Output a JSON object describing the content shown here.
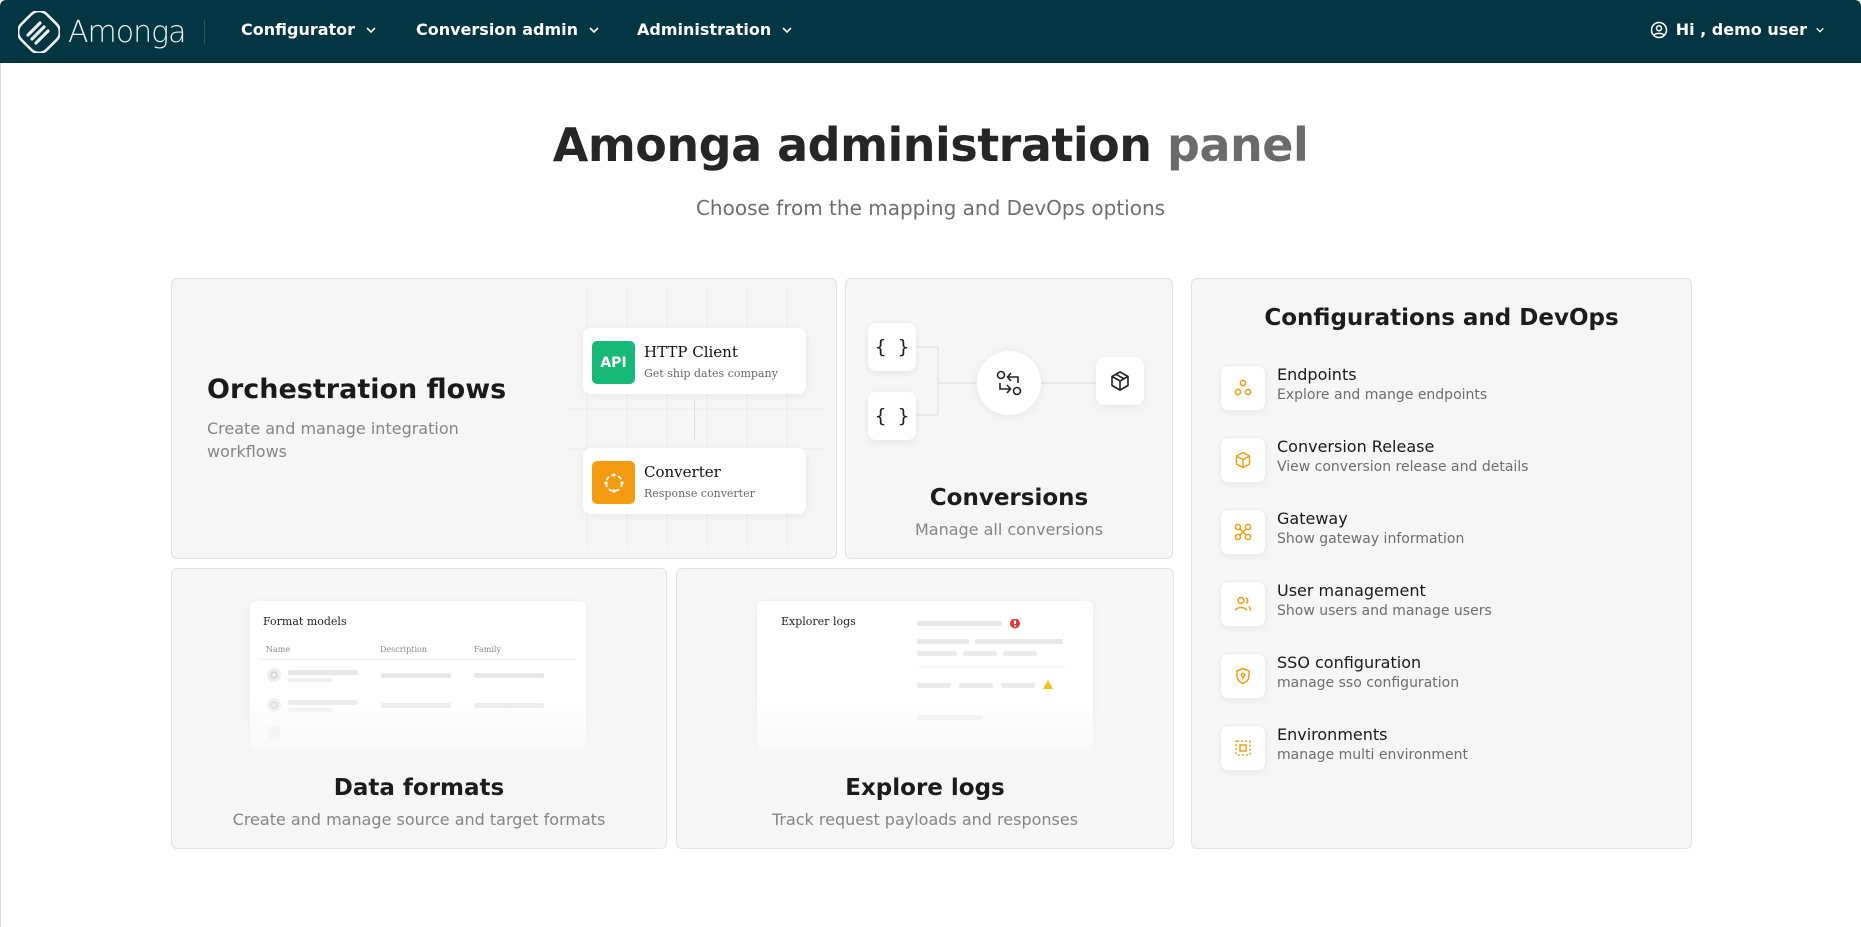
{
  "nav": {
    "logo_text": "Amonga",
    "menus": [
      {
        "label": "Configurator"
      },
      {
        "label": "Conversion admin"
      },
      {
        "label": "Administration"
      }
    ],
    "user_label": "Hi , demo user"
  },
  "hero": {
    "title_dark": "Amonga administration",
    "title_light": "panel",
    "subtitle": "Choose from the mapping and DevOps options"
  },
  "orchestration": {
    "title": "Orchestration flows",
    "description": "Create and manage integration workflows",
    "nodes": [
      {
        "badge": "API",
        "title": "HTTP Client",
        "subtitle": "Get ship dates company",
        "color": "#17b978"
      },
      {
        "badge": "",
        "title": "Converter",
        "subtitle": "Response converter",
        "color": "#f39c12"
      }
    ]
  },
  "conversions": {
    "title": "Conversions",
    "description": "Manage all conversions",
    "brace": "{ }"
  },
  "configurations": {
    "title": "Configurations and DevOps",
    "items": [
      {
        "label": "Endpoints",
        "description": "Explore and mange endpoints",
        "icon": "endpoints-icon"
      },
      {
        "label": "Conversion Release",
        "description": "View conversion release and details",
        "icon": "box-icon"
      },
      {
        "label": "Gateway",
        "description": "Show gateway information",
        "icon": "gateway-icon"
      },
      {
        "label": "User management",
        "description": "Show users and manage users",
        "icon": "users-icon"
      },
      {
        "label": "SSO configuration",
        "description": "manage sso configuration",
        "icon": "shield-icon"
      },
      {
        "label": "Environments",
        "description": "manage multi environment",
        "icon": "environment-icon"
      }
    ]
  },
  "data_formats": {
    "title": "Data formats",
    "description": "Create and manage source and target formats",
    "preview": {
      "title": "Format models",
      "columns": [
        "Name",
        "Description",
        "Family"
      ]
    }
  },
  "explore_logs": {
    "title": "Explore logs",
    "description": "Track request payloads and responses",
    "preview": {
      "title": "Explorer logs"
    }
  },
  "colors": {
    "topbar": "#043543",
    "accent_orange": "#f39c12",
    "accent_green": "#17b978",
    "error_red": "#e53935",
    "warning_yellow": "#f5c518"
  }
}
